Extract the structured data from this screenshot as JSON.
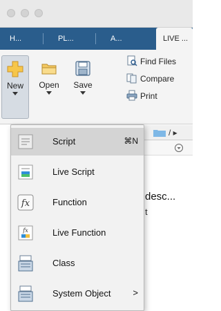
{
  "tabs": [
    {
      "label": "H...",
      "active": false
    },
    {
      "label": "PL...",
      "active": false
    },
    {
      "label": "A...",
      "active": false
    },
    {
      "label": "LIVE ...",
      "active": true
    }
  ],
  "toolstrip": {
    "new_label": "New",
    "open_label": "Open",
    "save_label": "Save",
    "find_files_label": "Find Files",
    "compare_label": "Compare",
    "print_label": "Print"
  },
  "background": {
    "path_text": "/ ▸",
    "desc_text": "desc...",
    "desc_text2": "t"
  },
  "new_menu": {
    "items": [
      {
        "label": "Script",
        "shortcut": "⌘N",
        "icon": "script-icon",
        "highlighted": true
      },
      {
        "label": "Live Script",
        "icon": "live-script-icon"
      },
      {
        "label": "Function",
        "icon": "function-icon"
      },
      {
        "label": "Live Function",
        "icon": "live-function-icon"
      },
      {
        "label": "Class",
        "icon": "class-icon"
      },
      {
        "label": "System Object",
        "icon": "system-object-icon",
        "submenu_arrow": ">"
      }
    ]
  },
  "colors": {
    "tab_bar": "#2a5d8c",
    "toolstrip": "#f4f4f4",
    "menu_bg": "#f2f2f2",
    "menu_highlight": "#d4d4d4"
  }
}
